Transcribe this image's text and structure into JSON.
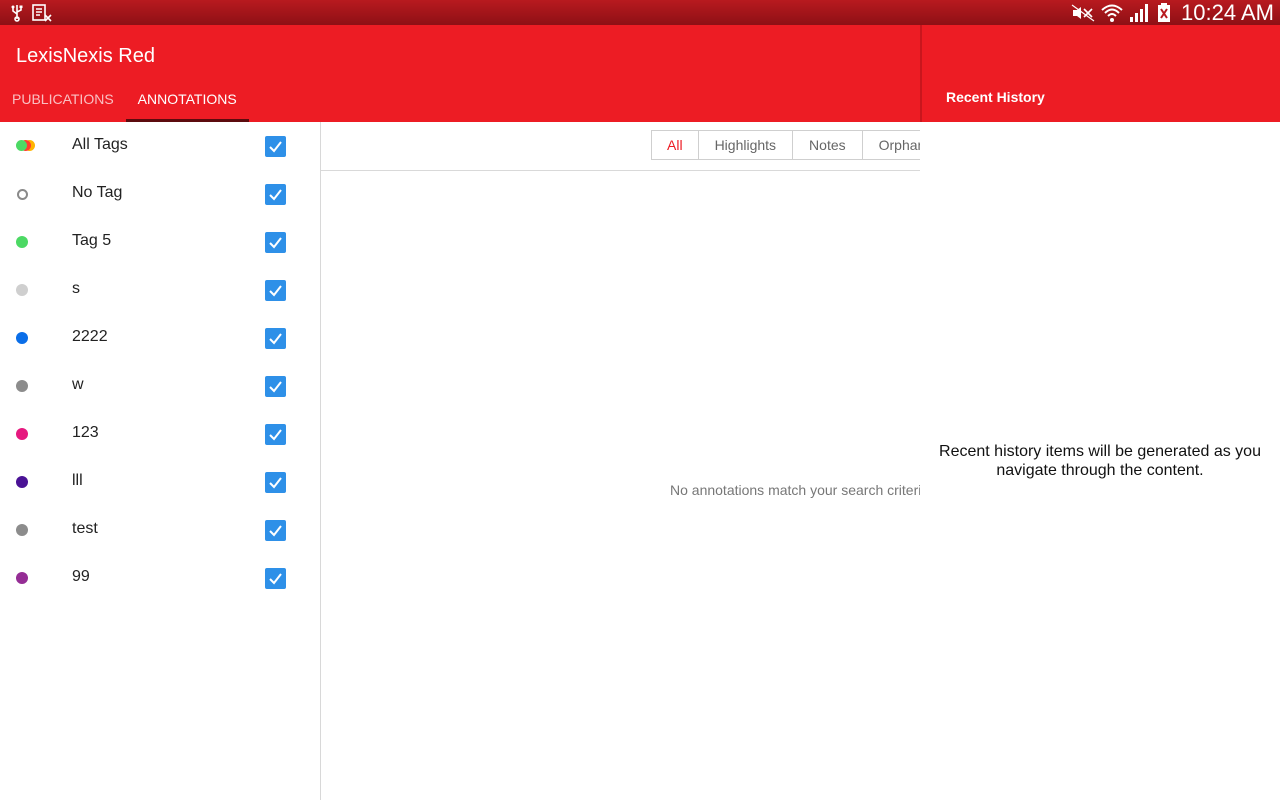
{
  "status_bar": {
    "time": "10:24 AM",
    "left_icons": [
      "usb-icon",
      "document-x-icon"
    ],
    "right_icons": [
      "mute-icon",
      "wifi-icon",
      "signal-icon",
      "battery-icon"
    ]
  },
  "app": {
    "title": "LexisNexis Red",
    "accent_color": "#ed1c24",
    "tabs": [
      {
        "label": "PUBLICATIONS",
        "active": false
      },
      {
        "label": "ANNOTATIONS",
        "active": true
      }
    ]
  },
  "tags": [
    {
      "label": "All Tags",
      "dot": "multi",
      "colors": [
        "#4cd964",
        "#ff3b30",
        "#ffb400"
      ],
      "checked": true
    },
    {
      "label": "No Tag",
      "dot": "hollow",
      "color": "#8a8a8a",
      "checked": true
    },
    {
      "label": "Tag 5",
      "dot": "solid",
      "color": "#4cd964",
      "checked": true
    },
    {
      "label": "s",
      "dot": "solid",
      "color": "#cfcfcf",
      "checked": true
    },
    {
      "label": "2222",
      "dot": "solid",
      "color": "#0a6ee8",
      "checked": true
    },
    {
      "label": "w",
      "dot": "solid",
      "color": "#8c8c8c",
      "checked": true
    },
    {
      "label": "123",
      "dot": "solid",
      "color": "#e6197f",
      "checked": true
    },
    {
      "label": "lll",
      "dot": "solid",
      "color": "#4a1295",
      "checked": true
    },
    {
      "label": "test",
      "dot": "solid",
      "color": "#8c8c8c",
      "checked": true
    },
    {
      "label": "99",
      "dot": "solid",
      "color": "#952d95",
      "checked": true
    }
  ],
  "filters": [
    {
      "label": "All",
      "active": true
    },
    {
      "label": "Highlights",
      "active": false
    },
    {
      "label": "Notes",
      "active": false
    },
    {
      "label": "Orphans",
      "active": false
    }
  ],
  "empty_message": "No annotations match your search criteria",
  "recent_history": {
    "title": "Recent History",
    "message": "Recent history items will be generated as you navigate through the content."
  }
}
